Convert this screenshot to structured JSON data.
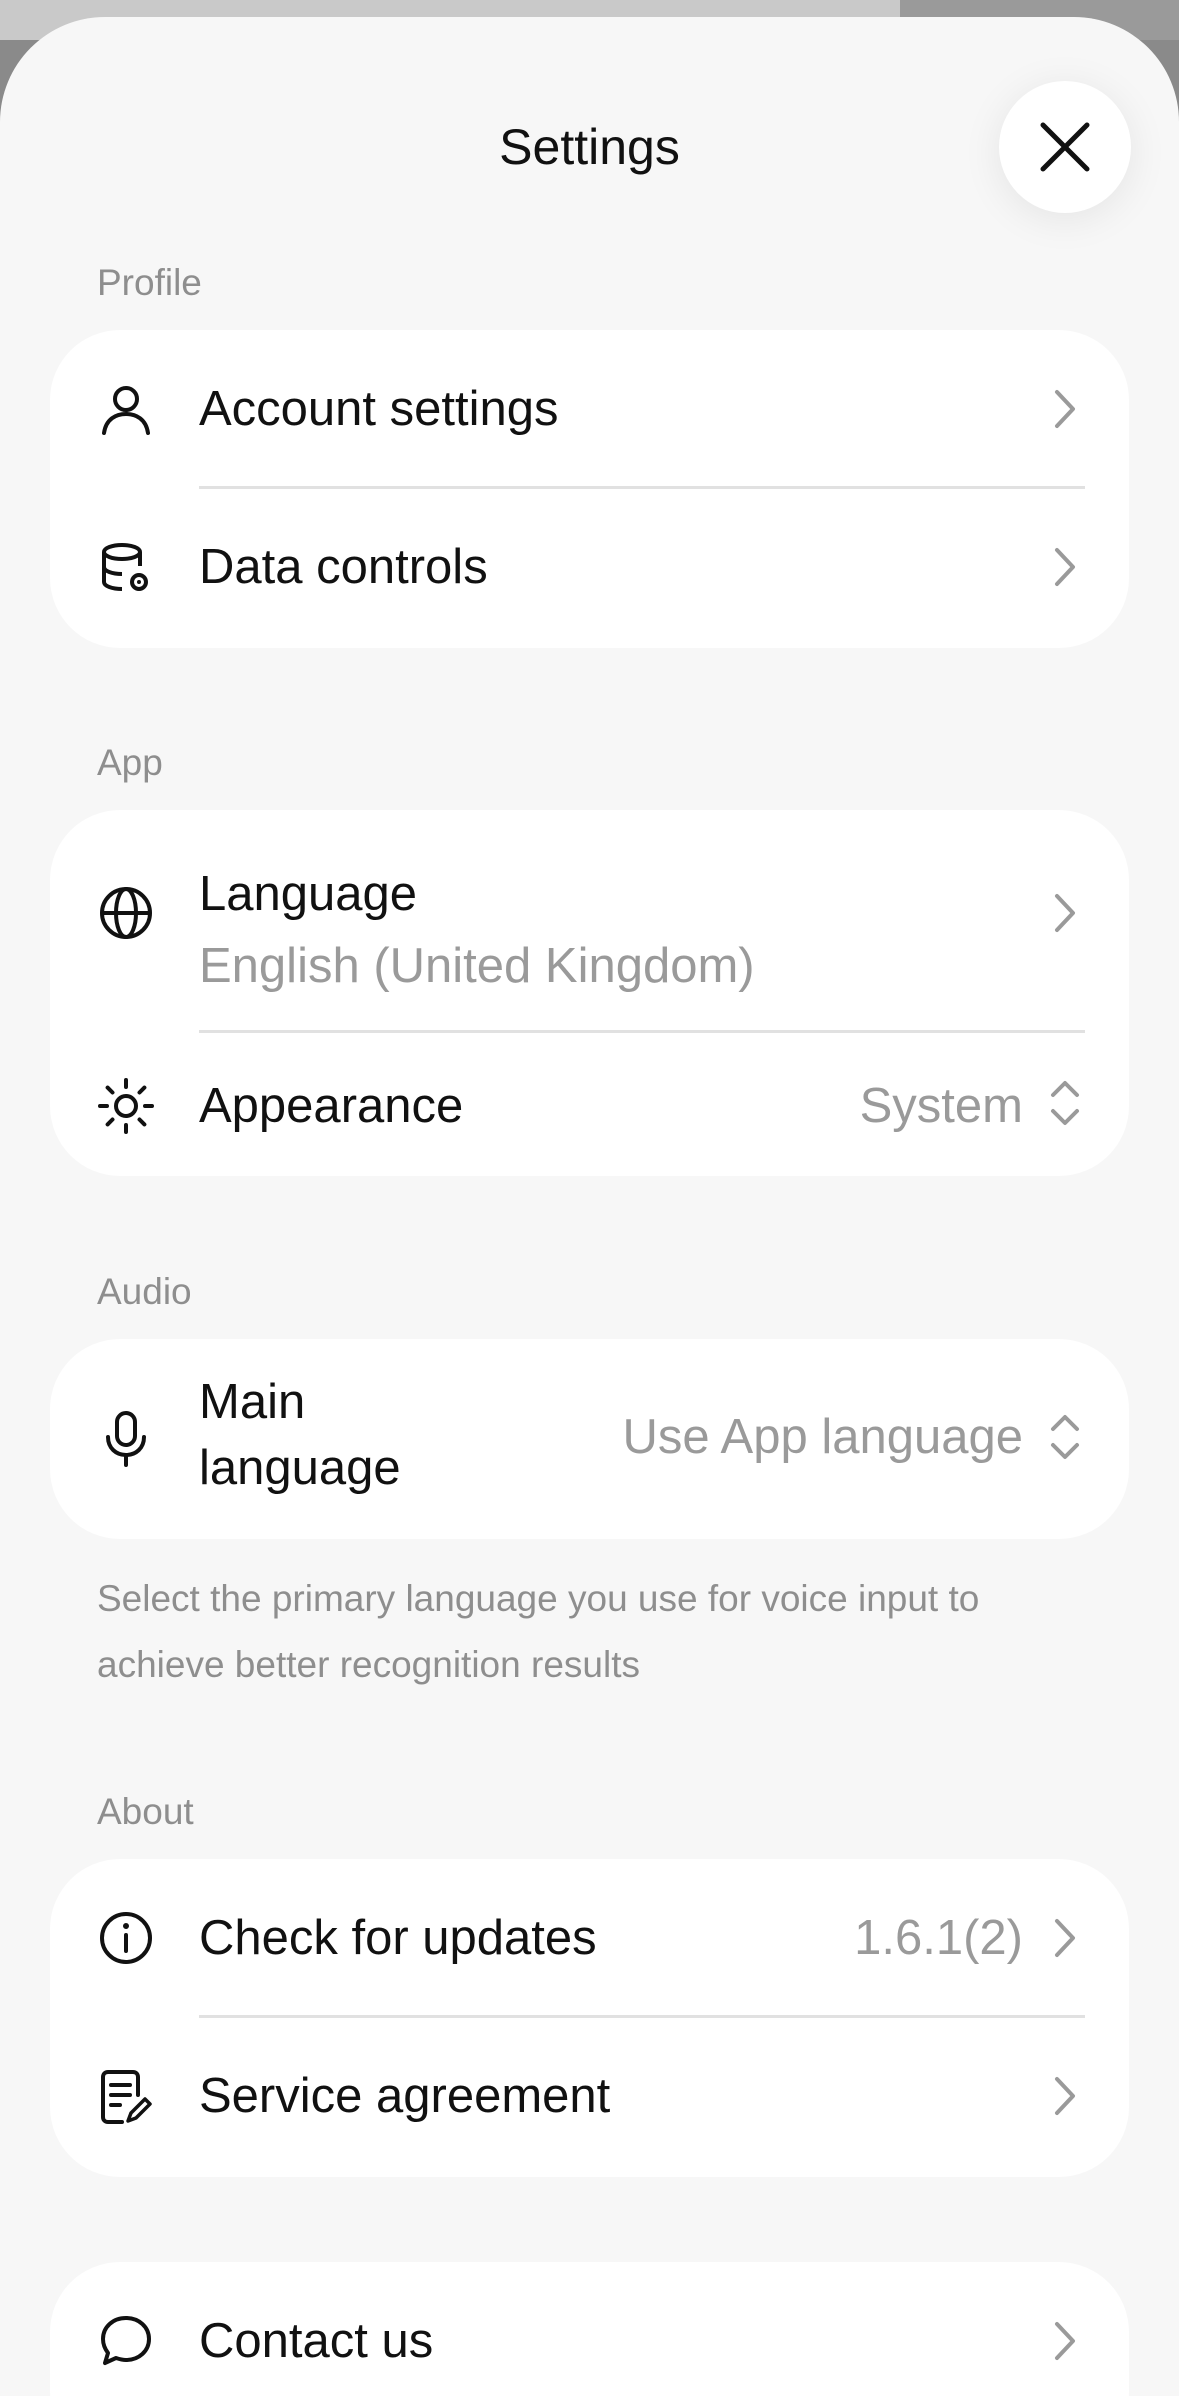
{
  "header": {
    "title": "Settings",
    "close_icon": "close-icon"
  },
  "profile": {
    "section_label": "Profile",
    "items": [
      {
        "label": "Account settings",
        "icon": "person-icon"
      },
      {
        "label": "Data controls",
        "icon": "database-gear-icon"
      }
    ]
  },
  "app": {
    "section_label": "App",
    "language": {
      "label": "Language",
      "value": "English (United Kingdom)",
      "icon": "globe-icon"
    },
    "appearance": {
      "label": "Appearance",
      "value": "System",
      "icon": "sun-icon"
    }
  },
  "audio": {
    "section_label": "Audio",
    "main_language": {
      "label_line1": "Main",
      "label_line2": "language",
      "value": "Use App language",
      "icon": "microphone-icon"
    },
    "help_text": "Select the primary language you use for voice input to achieve better recognition results"
  },
  "about": {
    "section_label": "About",
    "check_updates": {
      "label": "Check for updates",
      "value": "1.6.1(2)",
      "icon": "info-icon"
    },
    "service_agreement": {
      "label": "Service agreement",
      "icon": "document-edit-icon"
    }
  },
  "contact": {
    "label": "Contact us",
    "icon": "chat-bubble-icon"
  },
  "colors": {
    "background": "#f7f7f7",
    "card": "#ffffff",
    "text_primary": "#111111",
    "text_secondary": "#9a9a9a"
  }
}
